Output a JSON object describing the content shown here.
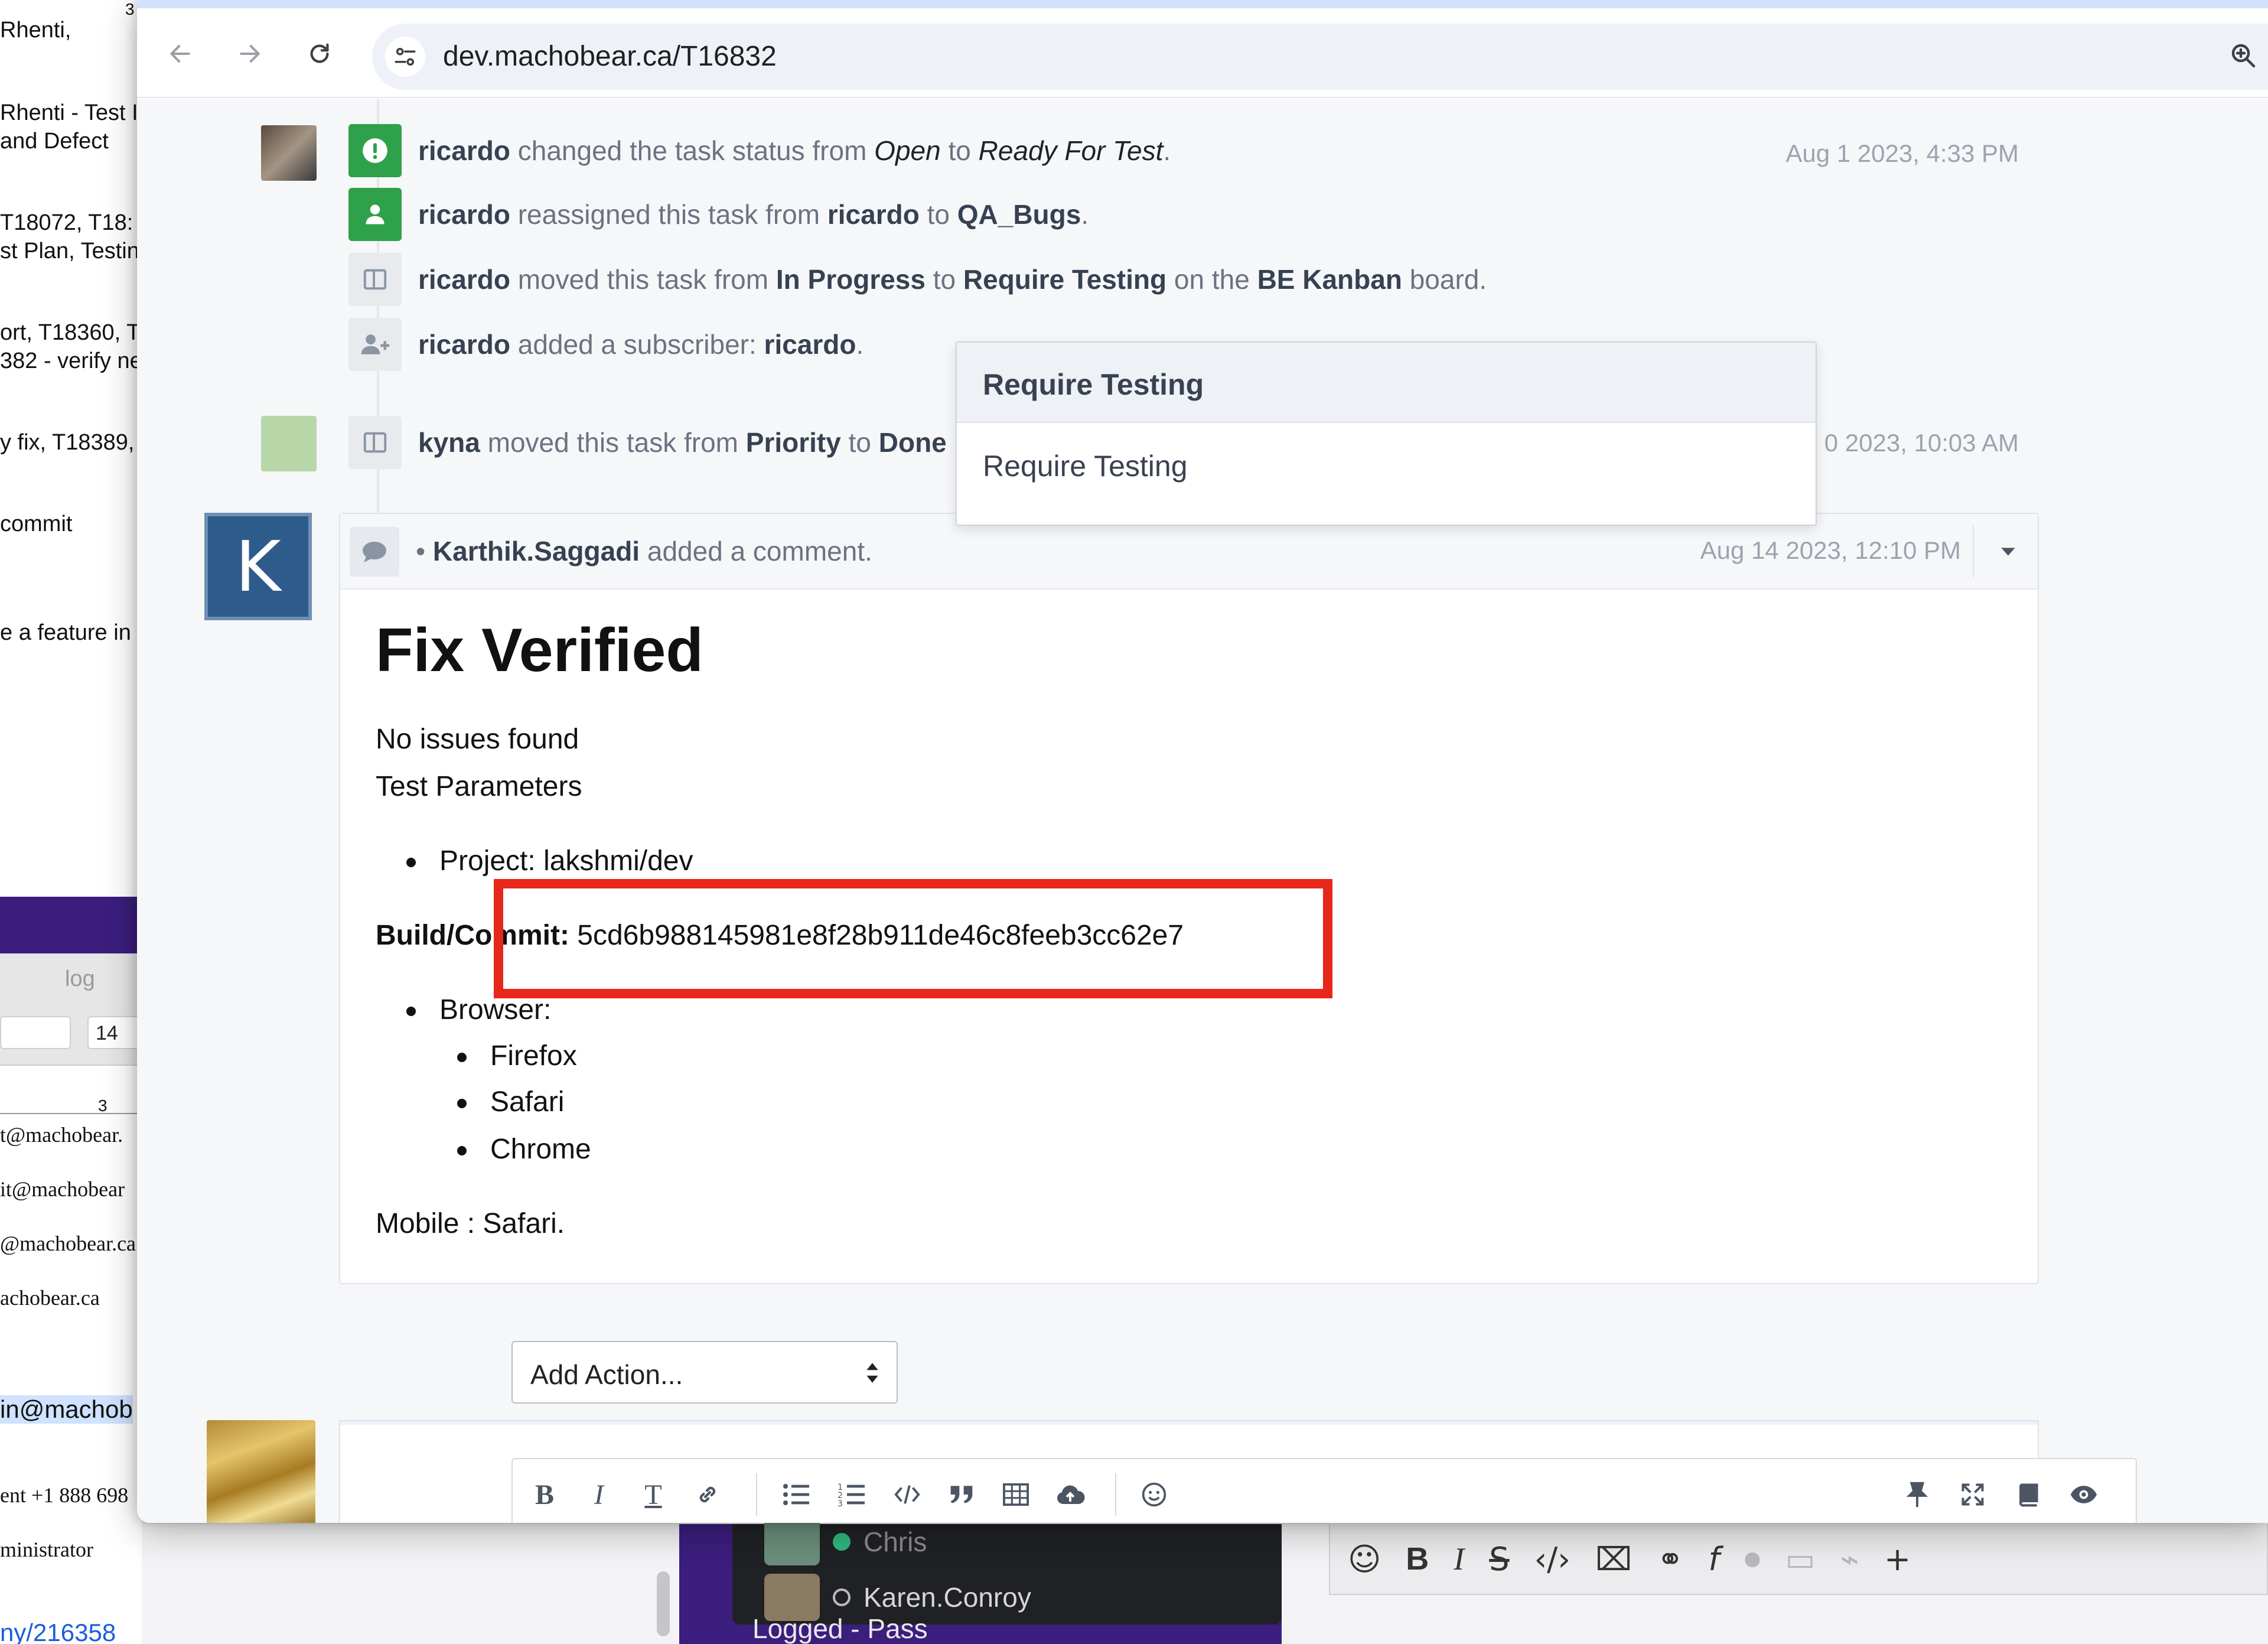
{
  "browser": {
    "url": "dev.machobear.ca/T16832"
  },
  "background_doc": {
    "lines": [
      "Rhenti,",
      "Rhenti - Test I",
      " and Defect",
      "T18072, T18:",
      "st Plan, Testin",
      "ort, T18360, T",
      "382 - verify ne",
      "y fix, T18389,",
      " commit",
      "e a feature in t",
      "log",
      "14",
      "3",
      "3",
      "t@machobear.",
      "it@machobear",
      "@machobear.ca",
      "achobear.ca",
      "in@machob",
      "ent +1 888 698",
      "ministrator",
      "ny/216358"
    ]
  },
  "timeline": {
    "events": [
      {
        "actor": "ricardo",
        "pre": " changed the task status from ",
        "from": "Open",
        "mid": " to ",
        "to": "Ready For Test",
        "post": ".",
        "date": "Aug 1 2023, 4:33 PM"
      },
      {
        "actor": "ricardo",
        "pre": " reassigned this task from ",
        "from": "ricardo",
        "mid": " to ",
        "to": "QA_Bugs",
        "post": "."
      },
      {
        "actor": "ricardo",
        "pre": " moved this task from ",
        "from": "In Progress",
        "mid": " to ",
        "to": "Require Testing",
        "mid2": " on the ",
        "board": "BE Kanban",
        "post": " board."
      },
      {
        "actor": "ricardo",
        "pre": " added a subscriber: ",
        "from": "ricardo",
        "post": "."
      },
      {
        "actor": "kyna",
        "pre": " moved this task from ",
        "from": "Priority",
        "mid": " to ",
        "to": "Done",
        "date": "0 2023, 10:03 AM"
      }
    ]
  },
  "popup": {
    "header": "Require Testing",
    "item": "Require Testing"
  },
  "comment": {
    "avatar_letter": "K",
    "bullet_dot": "•",
    "author": "Karthik.Saggadi",
    "action": " added a comment.",
    "date": "Aug 14 2023, 12:10 PM",
    "title": "Fix Verified",
    "line1": " No issues found",
    "line2": "Test Parameters",
    "project": "Project: lakshmi/dev",
    "build_label": "Build/Commit:",
    "build_value": " 5cd6b988145981e8f28b911de46c8feeb3cc62e7",
    "browser_label": "Browser:",
    "browsers": [
      "Firefox",
      "Safari",
      "Chrome"
    ],
    "mobile": "Mobile : Safari."
  },
  "composer": {
    "action_select": "Add Action...",
    "toolbar": [
      "bold",
      "italic",
      "text-size",
      "link",
      "bulleted-list",
      "numbered-list",
      "code",
      "quote",
      "table",
      "upload",
      "emoji",
      "pin",
      "fullscreen",
      "reference",
      "preview"
    ]
  },
  "bg_chat": {
    "users": [
      "Chris",
      "Karen.Conroy"
    ],
    "logged": "Logged - Pass"
  },
  "colors": {
    "accent_green": "#2ea14a",
    "highlight_red": "#e8271b",
    "avatar_blue": "#2d5c8c"
  }
}
